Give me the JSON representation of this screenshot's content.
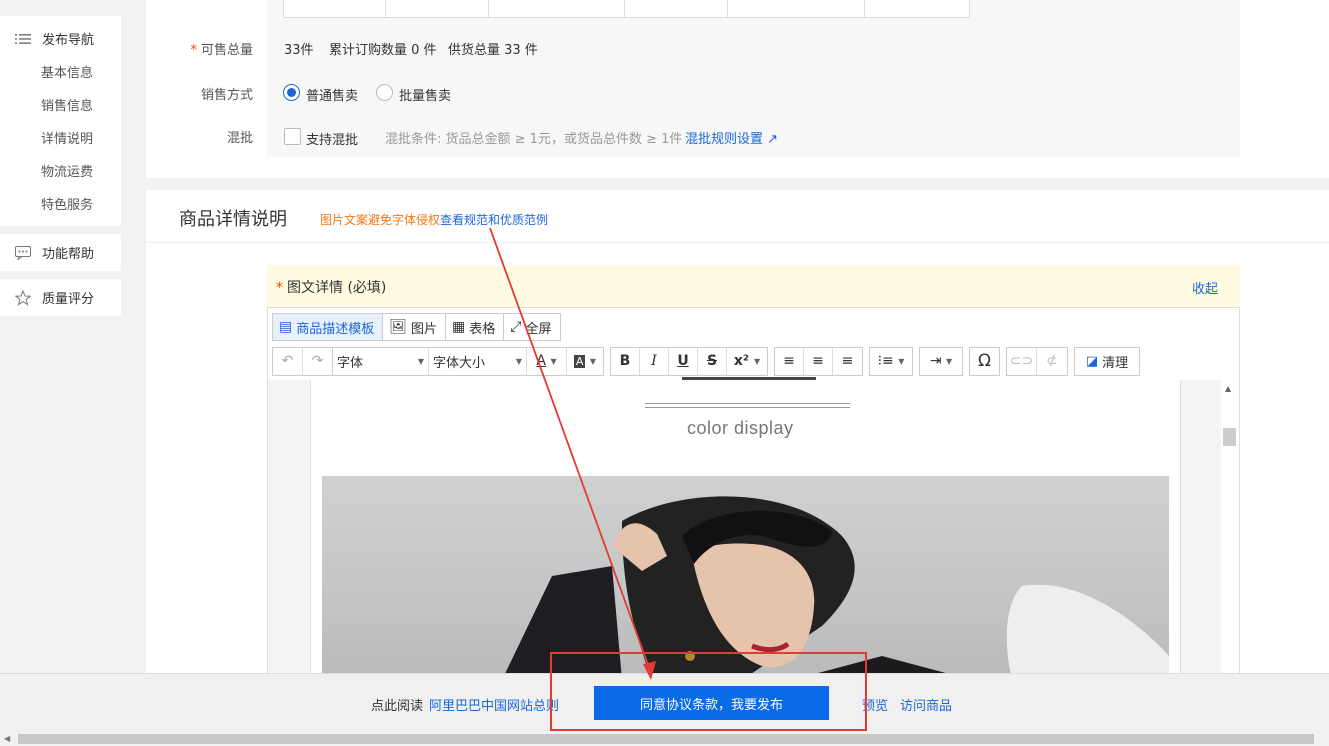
{
  "leftnav": {
    "publish_nav": "发布导航",
    "items": [
      "基本信息",
      "销售信息",
      "详情说明",
      "物流运费",
      "特色服务"
    ],
    "help": "功能帮助",
    "quality": "质量评分"
  },
  "sales": {
    "total_label": "可售总量",
    "total_value": "33件",
    "cumulative": "累计订购数量 0 件",
    "supply": "供货总量 33 件",
    "method_label": "销售方式",
    "method_normal": "普通售卖",
    "method_batch": "批量售卖",
    "mix_label": "混批",
    "mix_checkbox": "支持混批",
    "mix_condition": "混批条件: 货品总金额 ≥ 1元，或货品总件数 ≥ 1件",
    "mix_rule_link": "混批规则设置"
  },
  "detail": {
    "section_title": "商品详情说明",
    "note_orange": "图片文案避免字体侵权",
    "note_link": "查看规范和优质范例",
    "graphic_title": "图文详情 (必填)",
    "collapse": "收起"
  },
  "editor": {
    "tabs": [
      "商品描述模板",
      "图片",
      "表格",
      "全屏"
    ],
    "font_select": "字体",
    "size_select": "字体大小",
    "clear_label": "清理",
    "color_display": "color  display"
  },
  "bottom": {
    "read_prefix": "点此阅读",
    "rules_link": "阿里巴巴中国网站总则",
    "publish_button": "同意协议条款，我要发布",
    "preview": "预览",
    "visit": "访问商品"
  },
  "colors": {
    "accent_blue": "#1a66d9",
    "publish_blue": "#0a6be8",
    "annotation_red": "#e53935",
    "note_orange": "#f07a13"
  }
}
